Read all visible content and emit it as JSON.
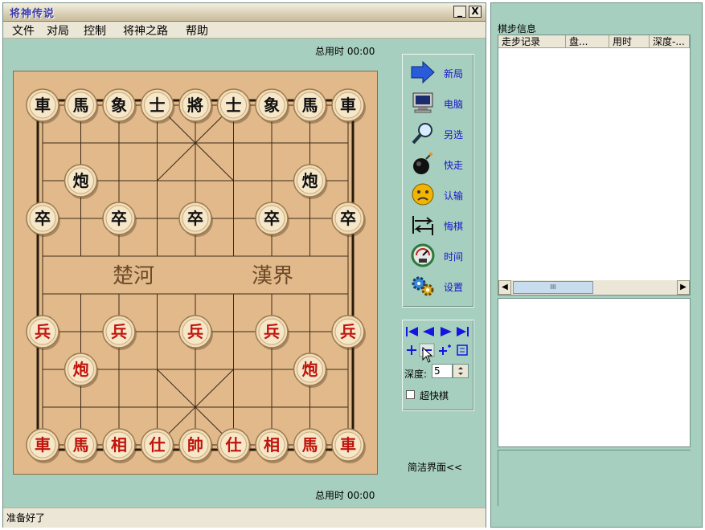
{
  "window": {
    "title": "将神传说",
    "minimize_label": "_",
    "close_label": "X"
  },
  "menu": [
    "文件",
    "对局",
    "控制",
    "将神之路",
    "帮助"
  ],
  "timer_top": "总用时 00:00",
  "timer_bottom": "总用时 00:00",
  "board": {
    "river_left": "楚河",
    "river_right": "漢界",
    "pieces": [
      {
        "c": 0,
        "r": 0,
        "t": "車",
        "side": "black"
      },
      {
        "c": 1,
        "r": 0,
        "t": "馬",
        "side": "black"
      },
      {
        "c": 2,
        "r": 0,
        "t": "象",
        "side": "black"
      },
      {
        "c": 3,
        "r": 0,
        "t": "士",
        "side": "black"
      },
      {
        "c": 4,
        "r": 0,
        "t": "將",
        "side": "black"
      },
      {
        "c": 5,
        "r": 0,
        "t": "士",
        "side": "black"
      },
      {
        "c": 6,
        "r": 0,
        "t": "象",
        "side": "black"
      },
      {
        "c": 7,
        "r": 0,
        "t": "馬",
        "side": "black"
      },
      {
        "c": 8,
        "r": 0,
        "t": "車",
        "side": "black"
      },
      {
        "c": 1,
        "r": 2,
        "t": "炮",
        "side": "black"
      },
      {
        "c": 7,
        "r": 2,
        "t": "炮",
        "side": "black"
      },
      {
        "c": 0,
        "r": 3,
        "t": "卒",
        "side": "black"
      },
      {
        "c": 2,
        "r": 3,
        "t": "卒",
        "side": "black"
      },
      {
        "c": 4,
        "r": 3,
        "t": "卒",
        "side": "black"
      },
      {
        "c": 6,
        "r": 3,
        "t": "卒",
        "side": "black"
      },
      {
        "c": 8,
        "r": 3,
        "t": "卒",
        "side": "black"
      },
      {
        "c": 0,
        "r": 6,
        "t": "兵",
        "side": "red"
      },
      {
        "c": 2,
        "r": 6,
        "t": "兵",
        "side": "red"
      },
      {
        "c": 4,
        "r": 6,
        "t": "兵",
        "side": "red"
      },
      {
        "c": 6,
        "r": 6,
        "t": "兵",
        "side": "red"
      },
      {
        "c": 8,
        "r": 6,
        "t": "兵",
        "side": "red"
      },
      {
        "c": 1,
        "r": 7,
        "t": "炮",
        "side": "red"
      },
      {
        "c": 7,
        "r": 7,
        "t": "炮",
        "side": "red"
      },
      {
        "c": 0,
        "r": 9,
        "t": "車",
        "side": "red"
      },
      {
        "c": 1,
        "r": 9,
        "t": "馬",
        "side": "red"
      },
      {
        "c": 2,
        "r": 9,
        "t": "相",
        "side": "red"
      },
      {
        "c": 3,
        "r": 9,
        "t": "仕",
        "side": "red"
      },
      {
        "c": 4,
        "r": 9,
        "t": "帥",
        "side": "red"
      },
      {
        "c": 5,
        "r": 9,
        "t": "仕",
        "side": "red"
      },
      {
        "c": 6,
        "r": 9,
        "t": "相",
        "side": "red"
      },
      {
        "c": 7,
        "r": 9,
        "t": "馬",
        "side": "red"
      },
      {
        "c": 8,
        "r": 9,
        "t": "車",
        "side": "red"
      }
    ]
  },
  "tools": [
    {
      "label": "新局",
      "icon": "arrow-icon"
    },
    {
      "label": "电脑",
      "icon": "monitor-icon"
    },
    {
      "label": "另选",
      "icon": "magnifier-icon"
    },
    {
      "label": "快走",
      "icon": "bomb-icon"
    },
    {
      "label": "认输",
      "icon": "sad-face-icon"
    },
    {
      "label": "悔棋",
      "icon": "undo-arrows-icon"
    },
    {
      "label": "时间",
      "icon": "speedometer-icon"
    },
    {
      "label": "设置",
      "icon": "gears-icon"
    }
  ],
  "nav": {
    "depth_label": "深度:",
    "depth_value": "5",
    "fast_label": "超快棋",
    "fast_checked": false
  },
  "simple_ui": "简洁界面<<",
  "status": "准备好了",
  "sidebar": {
    "title": "棋步信息",
    "columns": [
      "走步记录",
      "盘...",
      "用时",
      "深度-..."
    ],
    "scroll_thumb_label": "III"
  },
  "colors": {
    "bg": "#a7cfc0",
    "red_piece": "#c0140c",
    "black_piece": "#111111",
    "tool_label": "#1515c8"
  }
}
